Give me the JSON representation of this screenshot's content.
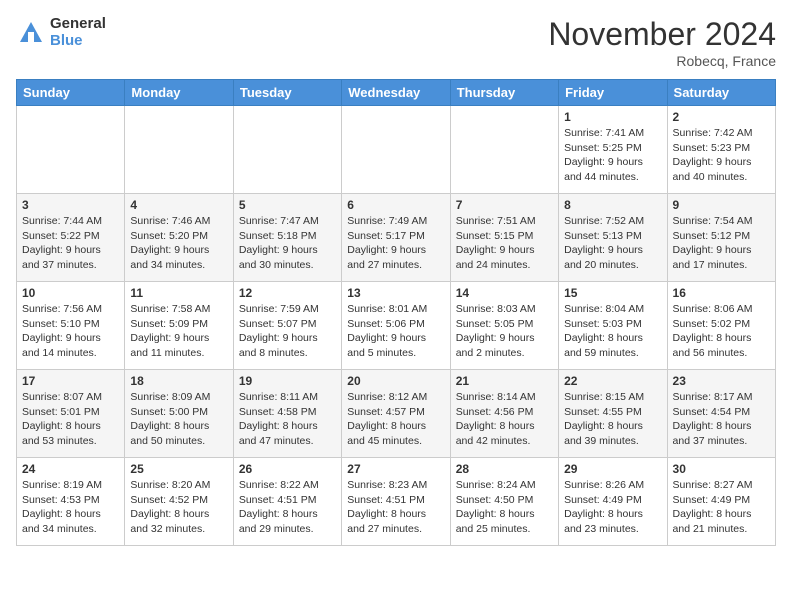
{
  "header": {
    "logo": {
      "general": "General",
      "blue": "Blue"
    },
    "title": "November 2024",
    "location": "Robecq, France"
  },
  "calendar": {
    "days_of_week": [
      "Sunday",
      "Monday",
      "Tuesday",
      "Wednesday",
      "Thursday",
      "Friday",
      "Saturday"
    ],
    "weeks": [
      [
        null,
        null,
        null,
        null,
        null,
        {
          "day": "1",
          "sunrise": "Sunrise: 7:41 AM",
          "sunset": "Sunset: 5:25 PM",
          "daylight": "Daylight: 9 hours and 44 minutes."
        },
        {
          "day": "2",
          "sunrise": "Sunrise: 7:42 AM",
          "sunset": "Sunset: 5:23 PM",
          "daylight": "Daylight: 9 hours and 40 minutes."
        }
      ],
      [
        {
          "day": "3",
          "sunrise": "Sunrise: 7:44 AM",
          "sunset": "Sunset: 5:22 PM",
          "daylight": "Daylight: 9 hours and 37 minutes."
        },
        {
          "day": "4",
          "sunrise": "Sunrise: 7:46 AM",
          "sunset": "Sunset: 5:20 PM",
          "daylight": "Daylight: 9 hours and 34 minutes."
        },
        {
          "day": "5",
          "sunrise": "Sunrise: 7:47 AM",
          "sunset": "Sunset: 5:18 PM",
          "daylight": "Daylight: 9 hours and 30 minutes."
        },
        {
          "day": "6",
          "sunrise": "Sunrise: 7:49 AM",
          "sunset": "Sunset: 5:17 PM",
          "daylight": "Daylight: 9 hours and 27 minutes."
        },
        {
          "day": "7",
          "sunrise": "Sunrise: 7:51 AM",
          "sunset": "Sunset: 5:15 PM",
          "daylight": "Daylight: 9 hours and 24 minutes."
        },
        {
          "day": "8",
          "sunrise": "Sunrise: 7:52 AM",
          "sunset": "Sunset: 5:13 PM",
          "daylight": "Daylight: 9 hours and 20 minutes."
        },
        {
          "day": "9",
          "sunrise": "Sunrise: 7:54 AM",
          "sunset": "Sunset: 5:12 PM",
          "daylight": "Daylight: 9 hours and 17 minutes."
        }
      ],
      [
        {
          "day": "10",
          "sunrise": "Sunrise: 7:56 AM",
          "sunset": "Sunset: 5:10 PM",
          "daylight": "Daylight: 9 hours and 14 minutes."
        },
        {
          "day": "11",
          "sunrise": "Sunrise: 7:58 AM",
          "sunset": "Sunset: 5:09 PM",
          "daylight": "Daylight: 9 hours and 11 minutes."
        },
        {
          "day": "12",
          "sunrise": "Sunrise: 7:59 AM",
          "sunset": "Sunset: 5:07 PM",
          "daylight": "Daylight: 9 hours and 8 minutes."
        },
        {
          "day": "13",
          "sunrise": "Sunrise: 8:01 AM",
          "sunset": "Sunset: 5:06 PM",
          "daylight": "Daylight: 9 hours and 5 minutes."
        },
        {
          "day": "14",
          "sunrise": "Sunrise: 8:03 AM",
          "sunset": "Sunset: 5:05 PM",
          "daylight": "Daylight: 9 hours and 2 minutes."
        },
        {
          "day": "15",
          "sunrise": "Sunrise: 8:04 AM",
          "sunset": "Sunset: 5:03 PM",
          "daylight": "Daylight: 8 hours and 59 minutes."
        },
        {
          "day": "16",
          "sunrise": "Sunrise: 8:06 AM",
          "sunset": "Sunset: 5:02 PM",
          "daylight": "Daylight: 8 hours and 56 minutes."
        }
      ],
      [
        {
          "day": "17",
          "sunrise": "Sunrise: 8:07 AM",
          "sunset": "Sunset: 5:01 PM",
          "daylight": "Daylight: 8 hours and 53 minutes."
        },
        {
          "day": "18",
          "sunrise": "Sunrise: 8:09 AM",
          "sunset": "Sunset: 5:00 PM",
          "daylight": "Daylight: 8 hours and 50 minutes."
        },
        {
          "day": "19",
          "sunrise": "Sunrise: 8:11 AM",
          "sunset": "Sunset: 4:58 PM",
          "daylight": "Daylight: 8 hours and 47 minutes."
        },
        {
          "day": "20",
          "sunrise": "Sunrise: 8:12 AM",
          "sunset": "Sunset: 4:57 PM",
          "daylight": "Daylight: 8 hours and 45 minutes."
        },
        {
          "day": "21",
          "sunrise": "Sunrise: 8:14 AM",
          "sunset": "Sunset: 4:56 PM",
          "daylight": "Daylight: 8 hours and 42 minutes."
        },
        {
          "day": "22",
          "sunrise": "Sunrise: 8:15 AM",
          "sunset": "Sunset: 4:55 PM",
          "daylight": "Daylight: 8 hours and 39 minutes."
        },
        {
          "day": "23",
          "sunrise": "Sunrise: 8:17 AM",
          "sunset": "Sunset: 4:54 PM",
          "daylight": "Daylight: 8 hours and 37 minutes."
        }
      ],
      [
        {
          "day": "24",
          "sunrise": "Sunrise: 8:19 AM",
          "sunset": "Sunset: 4:53 PM",
          "daylight": "Daylight: 8 hours and 34 minutes."
        },
        {
          "day": "25",
          "sunrise": "Sunrise: 8:20 AM",
          "sunset": "Sunset: 4:52 PM",
          "daylight": "Daylight: 8 hours and 32 minutes."
        },
        {
          "day": "26",
          "sunrise": "Sunrise: 8:22 AM",
          "sunset": "Sunset: 4:51 PM",
          "daylight": "Daylight: 8 hours and 29 minutes."
        },
        {
          "day": "27",
          "sunrise": "Sunrise: 8:23 AM",
          "sunset": "Sunset: 4:51 PM",
          "daylight": "Daylight: 8 hours and 27 minutes."
        },
        {
          "day": "28",
          "sunrise": "Sunrise: 8:24 AM",
          "sunset": "Sunset: 4:50 PM",
          "daylight": "Daylight: 8 hours and 25 minutes."
        },
        {
          "day": "29",
          "sunrise": "Sunrise: 8:26 AM",
          "sunset": "Sunset: 4:49 PM",
          "daylight": "Daylight: 8 hours and 23 minutes."
        },
        {
          "day": "30",
          "sunrise": "Sunrise: 8:27 AM",
          "sunset": "Sunset: 4:49 PM",
          "daylight": "Daylight: 8 hours and 21 minutes."
        }
      ]
    ]
  }
}
